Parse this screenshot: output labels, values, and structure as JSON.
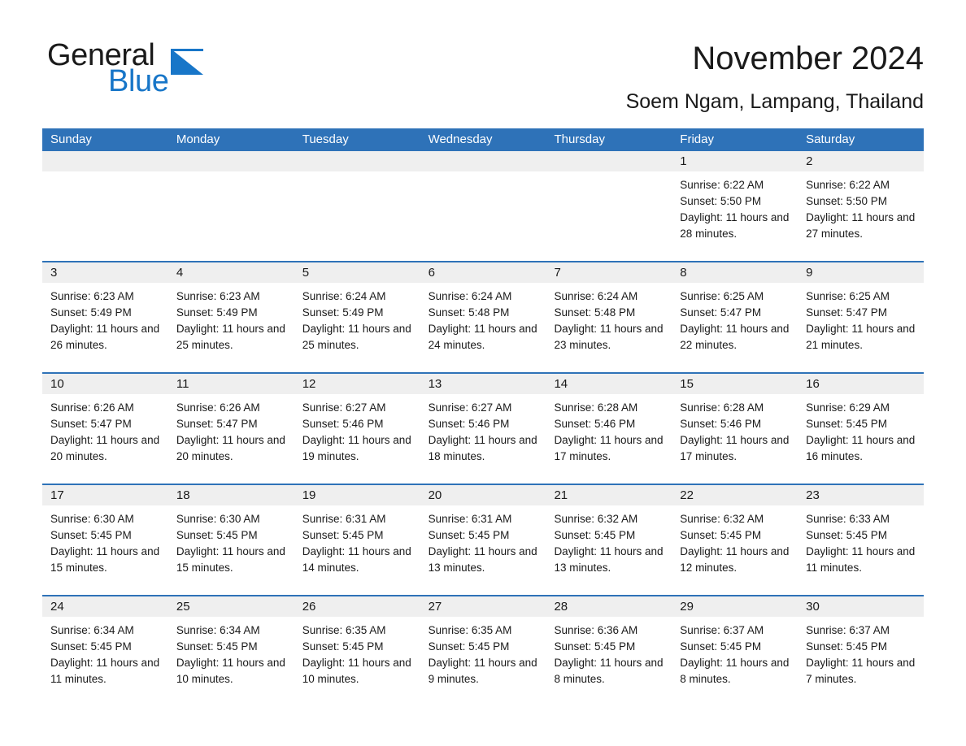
{
  "brand": {
    "name_part1": "General",
    "name_part2": "Blue",
    "triangle_icon": "brand-triangle-icon",
    "accent_color": "#1876c8"
  },
  "header": {
    "title": "November 2024",
    "subtitle": "Soem Ngam, Lampang, Thailand"
  },
  "theme": {
    "header_blue": "#2e72b8",
    "day_band_gray": "#efefef",
    "text": "#1a1a1a"
  },
  "calendar": {
    "weekdays": [
      "Sunday",
      "Monday",
      "Tuesday",
      "Wednesday",
      "Thursday",
      "Friday",
      "Saturday"
    ],
    "weeks": [
      [
        {
          "day": "",
          "empty": true
        },
        {
          "day": "",
          "empty": true
        },
        {
          "day": "",
          "empty": true
        },
        {
          "day": "",
          "empty": true
        },
        {
          "day": "",
          "empty": true
        },
        {
          "day": "1",
          "sunrise": "Sunrise: 6:22 AM",
          "sunset": "Sunset: 5:50 PM",
          "daylight": "Daylight: 11 hours and 28 minutes."
        },
        {
          "day": "2",
          "sunrise": "Sunrise: 6:22 AM",
          "sunset": "Sunset: 5:50 PM",
          "daylight": "Daylight: 11 hours and 27 minutes."
        }
      ],
      [
        {
          "day": "3",
          "sunrise": "Sunrise: 6:23 AM",
          "sunset": "Sunset: 5:49 PM",
          "daylight": "Daylight: 11 hours and 26 minutes."
        },
        {
          "day": "4",
          "sunrise": "Sunrise: 6:23 AM",
          "sunset": "Sunset: 5:49 PM",
          "daylight": "Daylight: 11 hours and 25 minutes."
        },
        {
          "day": "5",
          "sunrise": "Sunrise: 6:24 AM",
          "sunset": "Sunset: 5:49 PM",
          "daylight": "Daylight: 11 hours and 25 minutes."
        },
        {
          "day": "6",
          "sunrise": "Sunrise: 6:24 AM",
          "sunset": "Sunset: 5:48 PM",
          "daylight": "Daylight: 11 hours and 24 minutes."
        },
        {
          "day": "7",
          "sunrise": "Sunrise: 6:24 AM",
          "sunset": "Sunset: 5:48 PM",
          "daylight": "Daylight: 11 hours and 23 minutes."
        },
        {
          "day": "8",
          "sunrise": "Sunrise: 6:25 AM",
          "sunset": "Sunset: 5:47 PM",
          "daylight": "Daylight: 11 hours and 22 minutes."
        },
        {
          "day": "9",
          "sunrise": "Sunrise: 6:25 AM",
          "sunset": "Sunset: 5:47 PM",
          "daylight": "Daylight: 11 hours and 21 minutes."
        }
      ],
      [
        {
          "day": "10",
          "sunrise": "Sunrise: 6:26 AM",
          "sunset": "Sunset: 5:47 PM",
          "daylight": "Daylight: 11 hours and 20 minutes."
        },
        {
          "day": "11",
          "sunrise": "Sunrise: 6:26 AM",
          "sunset": "Sunset: 5:47 PM",
          "daylight": "Daylight: 11 hours and 20 minutes."
        },
        {
          "day": "12",
          "sunrise": "Sunrise: 6:27 AM",
          "sunset": "Sunset: 5:46 PM",
          "daylight": "Daylight: 11 hours and 19 minutes."
        },
        {
          "day": "13",
          "sunrise": "Sunrise: 6:27 AM",
          "sunset": "Sunset: 5:46 PM",
          "daylight": "Daylight: 11 hours and 18 minutes."
        },
        {
          "day": "14",
          "sunrise": "Sunrise: 6:28 AM",
          "sunset": "Sunset: 5:46 PM",
          "daylight": "Daylight: 11 hours and 17 minutes."
        },
        {
          "day": "15",
          "sunrise": "Sunrise: 6:28 AM",
          "sunset": "Sunset: 5:46 PM",
          "daylight": "Daylight: 11 hours and 17 minutes."
        },
        {
          "day": "16",
          "sunrise": "Sunrise: 6:29 AM",
          "sunset": "Sunset: 5:45 PM",
          "daylight": "Daylight: 11 hours and 16 minutes."
        }
      ],
      [
        {
          "day": "17",
          "sunrise": "Sunrise: 6:30 AM",
          "sunset": "Sunset: 5:45 PM",
          "daylight": "Daylight: 11 hours and 15 minutes."
        },
        {
          "day": "18",
          "sunrise": "Sunrise: 6:30 AM",
          "sunset": "Sunset: 5:45 PM",
          "daylight": "Daylight: 11 hours and 15 minutes."
        },
        {
          "day": "19",
          "sunrise": "Sunrise: 6:31 AM",
          "sunset": "Sunset: 5:45 PM",
          "daylight": "Daylight: 11 hours and 14 minutes."
        },
        {
          "day": "20",
          "sunrise": "Sunrise: 6:31 AM",
          "sunset": "Sunset: 5:45 PM",
          "daylight": "Daylight: 11 hours and 13 minutes."
        },
        {
          "day": "21",
          "sunrise": "Sunrise: 6:32 AM",
          "sunset": "Sunset: 5:45 PM",
          "daylight": "Daylight: 11 hours and 13 minutes."
        },
        {
          "day": "22",
          "sunrise": "Sunrise: 6:32 AM",
          "sunset": "Sunset: 5:45 PM",
          "daylight": "Daylight: 11 hours and 12 minutes."
        },
        {
          "day": "23",
          "sunrise": "Sunrise: 6:33 AM",
          "sunset": "Sunset: 5:45 PM",
          "daylight": "Daylight: 11 hours and 11 minutes."
        }
      ],
      [
        {
          "day": "24",
          "sunrise": "Sunrise: 6:34 AM",
          "sunset": "Sunset: 5:45 PM",
          "daylight": "Daylight: 11 hours and 11 minutes."
        },
        {
          "day": "25",
          "sunrise": "Sunrise: 6:34 AM",
          "sunset": "Sunset: 5:45 PM",
          "daylight": "Daylight: 11 hours and 10 minutes."
        },
        {
          "day": "26",
          "sunrise": "Sunrise: 6:35 AM",
          "sunset": "Sunset: 5:45 PM",
          "daylight": "Daylight: 11 hours and 10 minutes."
        },
        {
          "day": "27",
          "sunrise": "Sunrise: 6:35 AM",
          "sunset": "Sunset: 5:45 PM",
          "daylight": "Daylight: 11 hours and 9 minutes."
        },
        {
          "day": "28",
          "sunrise": "Sunrise: 6:36 AM",
          "sunset": "Sunset: 5:45 PM",
          "daylight": "Daylight: 11 hours and 8 minutes."
        },
        {
          "day": "29",
          "sunrise": "Sunrise: 6:37 AM",
          "sunset": "Sunset: 5:45 PM",
          "daylight": "Daylight: 11 hours and 8 minutes."
        },
        {
          "day": "30",
          "sunrise": "Sunrise: 6:37 AM",
          "sunset": "Sunset: 5:45 PM",
          "daylight": "Daylight: 11 hours and 7 minutes."
        }
      ]
    ]
  }
}
